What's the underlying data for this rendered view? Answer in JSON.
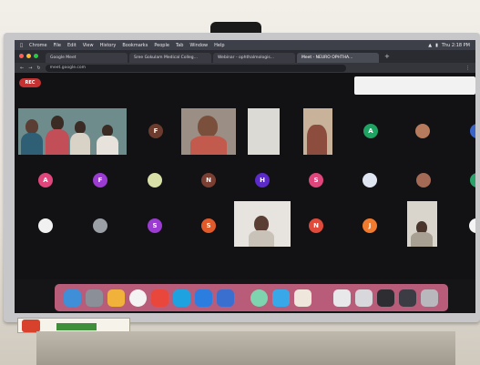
{
  "menubar": {
    "items": [
      "Chrome",
      "File",
      "Edit",
      "View",
      "History",
      "Bookmarks",
      "People",
      "Tab",
      "Window",
      "Help"
    ],
    "clock": "Thu 2:18 PM"
  },
  "tabs": [
    {
      "label": "Google Meet"
    },
    {
      "label": "Sree Gokulam Medical Colleg..."
    },
    {
      "label": "Webinar - ophthalmologis..."
    },
    {
      "label": "Meet - NEURO OPHTHA..."
    }
  ],
  "address": {
    "url": "meet.google.com"
  },
  "meet": {
    "rec_label": "REC",
    "avatars": [
      {
        "letter": "F",
        "color": "#6b3b2e"
      },
      {
        "letter": "A",
        "color": "#1ea362"
      },
      {
        "letter": "A",
        "color": "#e0457b"
      },
      {
        "letter": "F",
        "color": "#9b3bd1"
      },
      {
        "letter": "N",
        "color": "#7a3f32"
      },
      {
        "letter": "H",
        "color": "#5b2ac9"
      },
      {
        "letter": "S",
        "color": "#e0457b"
      },
      {
        "letter": "S",
        "color": "#9b3bd1"
      },
      {
        "letter": "S",
        "color": "#e05a2a"
      },
      {
        "letter": "N",
        "color": "#e04a3a"
      },
      {
        "letter": "J",
        "color": "#f07b2e"
      }
    ]
  },
  "colors": {
    "screen": "#151518",
    "dock": "#d6688c",
    "bezel": "#c7c7c9"
  }
}
